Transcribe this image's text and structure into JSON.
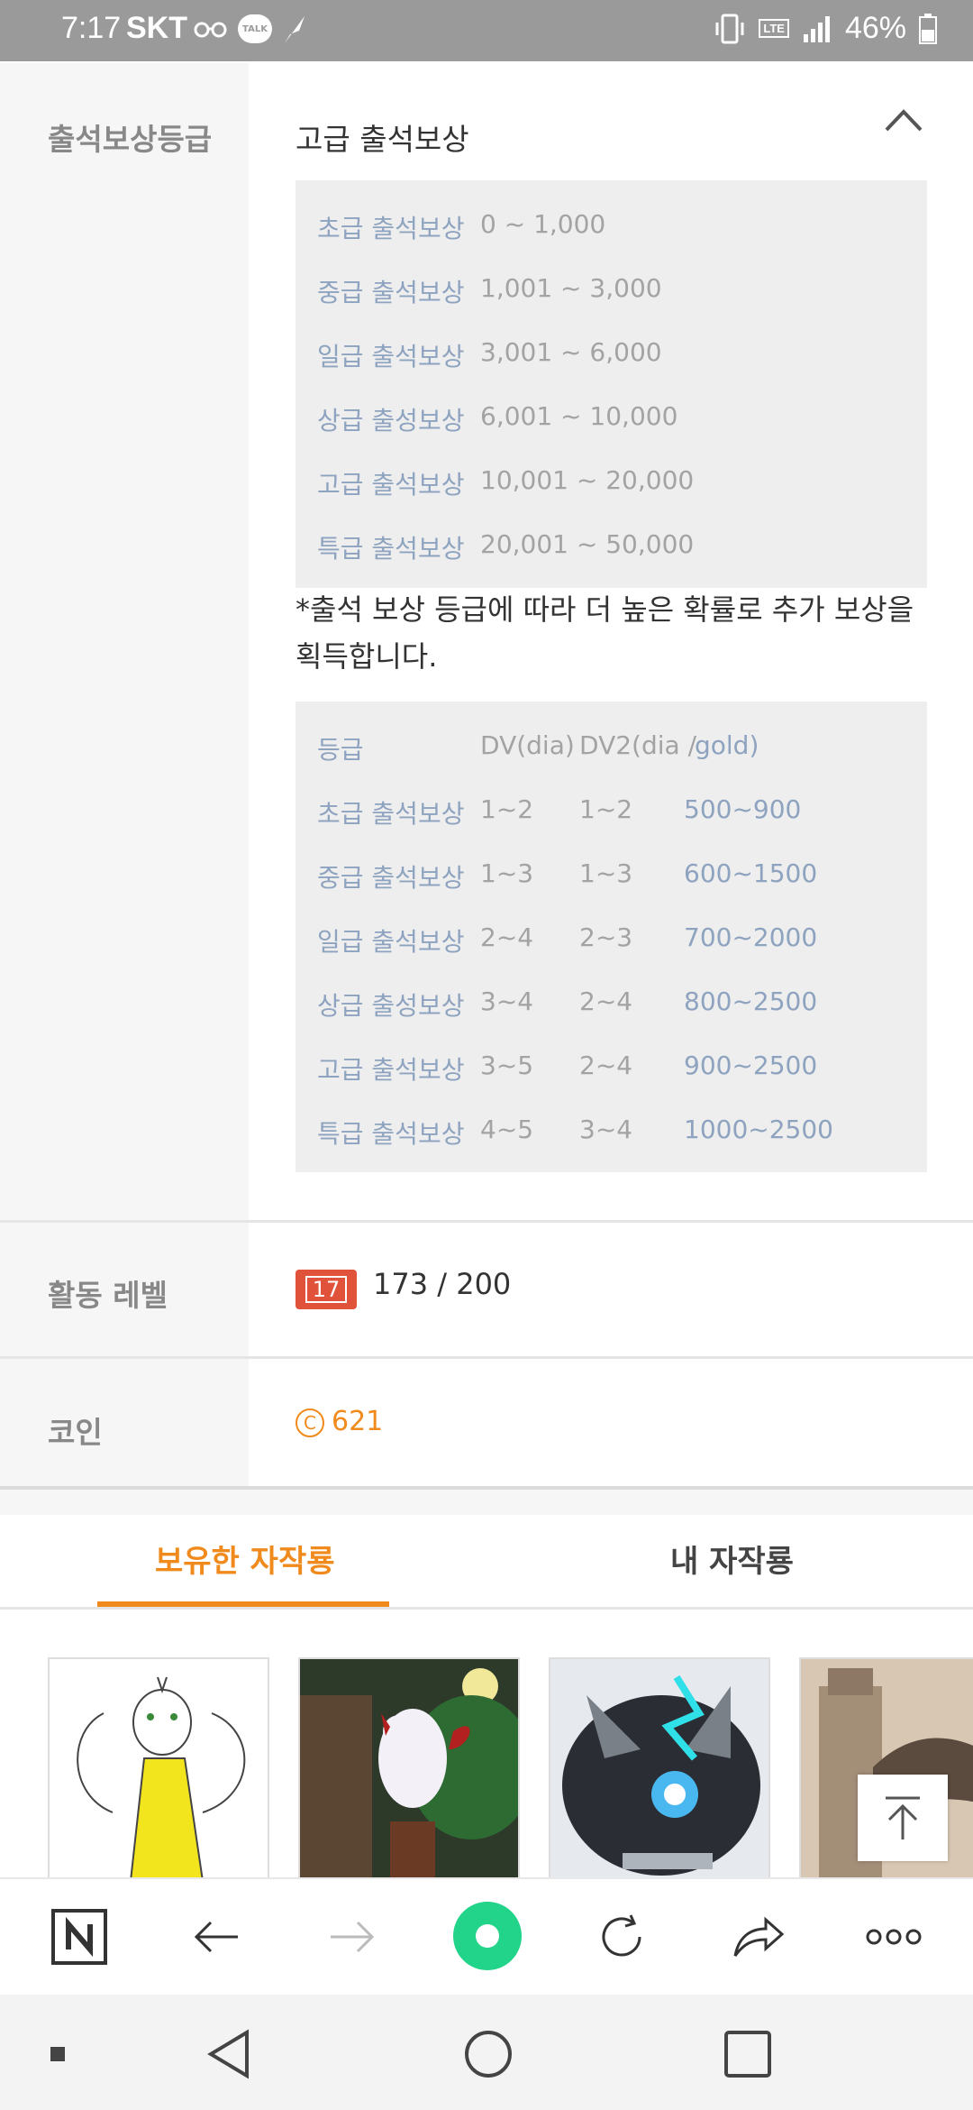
{
  "status_bar": {
    "time": "7:17",
    "carrier": "SKT",
    "battery": "46%",
    "talk_badge": "TALK",
    "lte_badge": "LTE"
  },
  "attendance": {
    "label": "출석보상등급",
    "current": "고급 출석보상",
    "ranges": [
      {
        "name": "초급 출석보상",
        "range": "0 ~ 1,000"
      },
      {
        "name": "중급 출석보상",
        "range": "1,001 ~ 3,000"
      },
      {
        "name": "일급 출석보상",
        "range": "3,001 ~ 6,000"
      },
      {
        "name": "상급 출성보상",
        "range": "6,001 ~ 10,000"
      },
      {
        "name": "고급 출석보상",
        "range": "10,001 ~ 20,000"
      },
      {
        "name": "특급 출석보상",
        "range": "20,001 ~ 50,000"
      }
    ],
    "note": "*출석 보상 등급에 따라 더 높은 확률로 추가 보상을 획득합니다.",
    "reward_table": {
      "headers": [
        "등급",
        "DV(dia)",
        "DV2(dia /",
        "gold)"
      ],
      "rows": [
        [
          "초급 출석보상",
          "1~2",
          "1~2",
          "500~900"
        ],
        [
          "중급 출석보상",
          "1~3",
          "1~3",
          "600~1500"
        ],
        [
          "일급 출석보상",
          "2~4",
          "2~3",
          "700~2000"
        ],
        [
          "상급 출성보상",
          "3~4",
          "2~4",
          "800~2500"
        ],
        [
          "고급 출석보상",
          "3~5",
          "2~4",
          "900~2500"
        ],
        [
          "특급 출석보상",
          "4~5",
          "3~4",
          "1000~2500"
        ]
      ]
    }
  },
  "activity": {
    "label": "활동 레벨",
    "badge": "17",
    "value": "173 / 200"
  },
  "coin": {
    "label": "코인",
    "symbol": "C",
    "value": "621"
  },
  "tabs": [
    {
      "label": "보유한 자작룡",
      "active": true
    },
    {
      "label": "내 자작룡",
      "active": false
    }
  ],
  "colors": {
    "accent": "#f08a1c",
    "status_bar": "#9a9a9a",
    "label_gray": "#888888",
    "grade_blue": "#8ea3bf",
    "badge_red": "#e0533a",
    "nav_green": "#22d38a"
  },
  "browser_bar": {
    "icons": [
      "naver-icon",
      "back-arrow-icon",
      "forward-arrow-icon",
      "home-circle-icon",
      "refresh-icon",
      "share-icon",
      "more-icon"
    ]
  },
  "system_nav": {
    "icons": [
      "square-dot-icon",
      "back-triangle-icon",
      "home-circle-icon",
      "recents-square-icon"
    ]
  }
}
